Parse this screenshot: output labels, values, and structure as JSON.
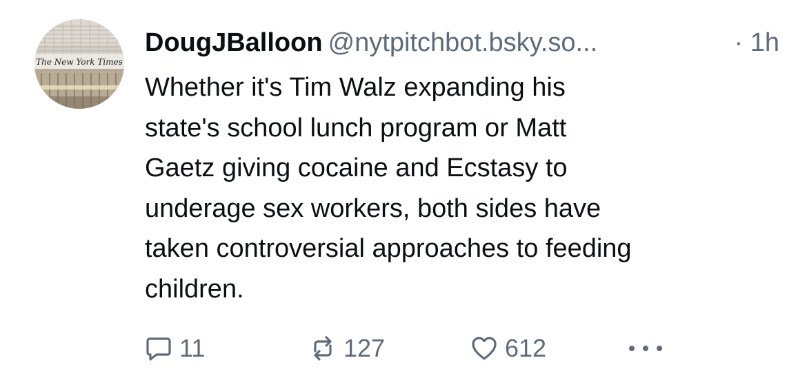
{
  "post": {
    "avatar": {
      "description_icon": "nyt-building-avatar",
      "sign_text": "The New York Times"
    },
    "author": {
      "display_name": "DougJBalloon",
      "handle": "@nytpitchbot.bsky.so..."
    },
    "timestamp": "· 1h",
    "text": "Whether it's Tim Walz expanding his\nstate's school lunch program or Matt\nGaetz giving cocaine and Ecstasy to\nunderage sex workers, both sides have\ntaken controversial approaches to feeding\nchildren.",
    "actions": {
      "reply": {
        "icon": "reply-icon",
        "count": "11"
      },
      "repost": {
        "icon": "repost-icon",
        "count": "127"
      },
      "like": {
        "icon": "heart-icon",
        "count": "612"
      },
      "more": {
        "icon": "more-icon"
      }
    }
  },
  "colors": {
    "text_primary": "#0b0f14",
    "text_secondary": "#5e6b7a",
    "background": "#ffffff"
  }
}
